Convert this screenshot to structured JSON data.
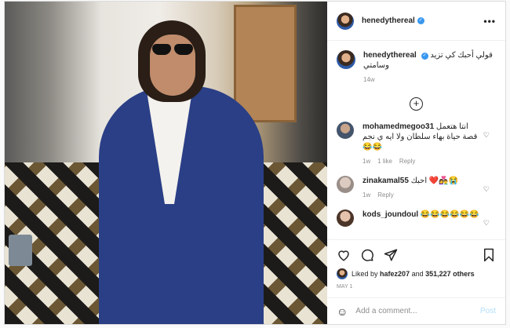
{
  "post": {
    "username": "henedythereal",
    "more_icon": "•••",
    "caption": {
      "username": "henedythereal",
      "text": "قولي أحبك كي تزيد وسامتي",
      "time": "14w"
    },
    "comments": [
      {
        "username": "mohamedmegoo31",
        "text": "انتا هتعمل قصة حياة بهاء سلطان ولا ايه ي نجم 😂😂",
        "time": "1w",
        "likes": "1 like",
        "reply": "Reply"
      },
      {
        "username": "zinakamal55",
        "text": "احبك ❤️👩‍❤️‍👨😭",
        "time": "1w",
        "reply": "Reply"
      },
      {
        "username": "kods_joundoul",
        "text": "😂😂😂😂😂😂",
        "time": "",
        "reply": ""
      }
    ],
    "likes": {
      "prefix": "Liked by ",
      "user": "hafez207",
      "middle": " and ",
      "count": "351,227 others"
    },
    "date": "MAY 1",
    "add_comment_placeholder": "Add a comment...",
    "post_button": "Post",
    "emoji_icon": "☺",
    "plus_icon": "+",
    "heart_icon": "♡"
  }
}
